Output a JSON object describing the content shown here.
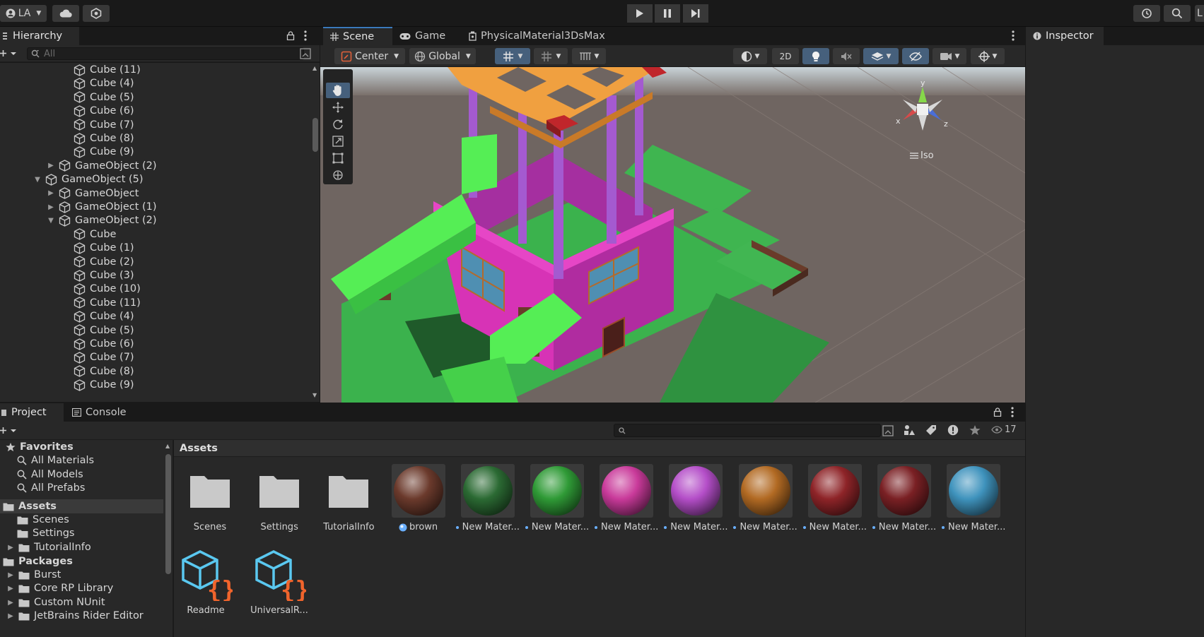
{
  "topbar": {
    "account_label": "LA",
    "layout_label": "L"
  },
  "hierarchy": {
    "tab_label": "Hierarchy",
    "search_placeholder": "All",
    "rows": [
      {
        "label": "Cube (11)",
        "indent": 4,
        "arrow": ""
      },
      {
        "label": "Cube (4)",
        "indent": 4,
        "arrow": ""
      },
      {
        "label": "Cube (5)",
        "indent": 4,
        "arrow": ""
      },
      {
        "label": "Cube (6)",
        "indent": 4,
        "arrow": ""
      },
      {
        "label": "Cube (7)",
        "indent": 4,
        "arrow": ""
      },
      {
        "label": "Cube (8)",
        "indent": 4,
        "arrow": ""
      },
      {
        "label": "Cube (9)",
        "indent": 4,
        "arrow": ""
      },
      {
        "label": "GameObject (2)",
        "indent": 3,
        "arrow": "collapsed"
      },
      {
        "label": "GameObject (5)",
        "indent": 2,
        "arrow": "expanded"
      },
      {
        "label": "GameObject",
        "indent": 3,
        "arrow": "collapsed"
      },
      {
        "label": "GameObject (1)",
        "indent": 3,
        "arrow": "collapsed"
      },
      {
        "label": "GameObject (2)",
        "indent": 3,
        "arrow": "expanded"
      },
      {
        "label": "Cube",
        "indent": 4,
        "arrow": ""
      },
      {
        "label": "Cube (1)",
        "indent": 4,
        "arrow": ""
      },
      {
        "label": "Cube (2)",
        "indent": 4,
        "arrow": ""
      },
      {
        "label": "Cube (3)",
        "indent": 4,
        "arrow": ""
      },
      {
        "label": "Cube (10)",
        "indent": 4,
        "arrow": ""
      },
      {
        "label": "Cube (11)",
        "indent": 4,
        "arrow": ""
      },
      {
        "label": "Cube (4)",
        "indent": 4,
        "arrow": ""
      },
      {
        "label": "Cube (5)",
        "indent": 4,
        "arrow": ""
      },
      {
        "label": "Cube (6)",
        "indent": 4,
        "arrow": ""
      },
      {
        "label": "Cube (7)",
        "indent": 4,
        "arrow": ""
      },
      {
        "label": "Cube (8)",
        "indent": 4,
        "arrow": ""
      },
      {
        "label": "Cube (9)",
        "indent": 4,
        "arrow": ""
      }
    ]
  },
  "scene": {
    "tabs": [
      "Scene",
      "Game",
      "PhysicalMaterial3DsMax"
    ],
    "pivot_label": "Center",
    "space_label": "Global",
    "mode_2d_label": "2D",
    "projection_label": "Iso",
    "gizmo_axes": [
      "y",
      "x",
      "z"
    ]
  },
  "inspector": {
    "tab_label": "Inspector"
  },
  "project": {
    "tabs": [
      "Project",
      "Console"
    ],
    "visible_count": "17",
    "breadcrumb": "Assets",
    "tree": [
      {
        "label": "Favorites",
        "type": "header-star"
      },
      {
        "label": "All Materials",
        "type": "search"
      },
      {
        "label": "All Models",
        "type": "search"
      },
      {
        "label": "All Prefabs",
        "type": "search"
      },
      {
        "label": "Assets",
        "type": "header-folder"
      },
      {
        "label": "Scenes",
        "type": "folder"
      },
      {
        "label": "Settings",
        "type": "folder"
      },
      {
        "label": "TutorialInfo",
        "type": "folder-arrow"
      },
      {
        "label": "Packages",
        "type": "header-folder"
      },
      {
        "label": "Burst",
        "type": "folder-arrow"
      },
      {
        "label": "Core RP Library",
        "type": "folder-arrow"
      },
      {
        "label": "Custom NUnit",
        "type": "folder-arrow"
      },
      {
        "label": "JetBrains Rider Editor",
        "type": "folder-arrow"
      }
    ],
    "assets": [
      {
        "label": "Scenes",
        "kind": "folder"
      },
      {
        "label": "Settings",
        "kind": "folder"
      },
      {
        "label": "TutorialInfo",
        "kind": "folder"
      },
      {
        "label": "brown",
        "kind": "material",
        "color": "#6b3a2c"
      },
      {
        "label": "New Mater...",
        "kind": "material",
        "color": "#2b6a33"
      },
      {
        "label": "New Mater...",
        "kind": "material",
        "color": "#2f9a36"
      },
      {
        "label": "New Mater...",
        "kind": "material",
        "color": "#c93a9a"
      },
      {
        "label": "New Mater...",
        "kind": "material",
        "color": "#b44ec8"
      },
      {
        "label": "New Mater...",
        "kind": "material",
        "color": "#b26a23"
      },
      {
        "label": "New Mater...",
        "kind": "material",
        "color": "#8e2428"
      },
      {
        "label": "New Mater...",
        "kind": "material",
        "color": "#7a2024"
      },
      {
        "label": "New Mater...",
        "kind": "material",
        "color": "#3f93bd"
      },
      {
        "label": "Readme",
        "kind": "script"
      },
      {
        "label": "UniversalR...",
        "kind": "script"
      }
    ]
  }
}
